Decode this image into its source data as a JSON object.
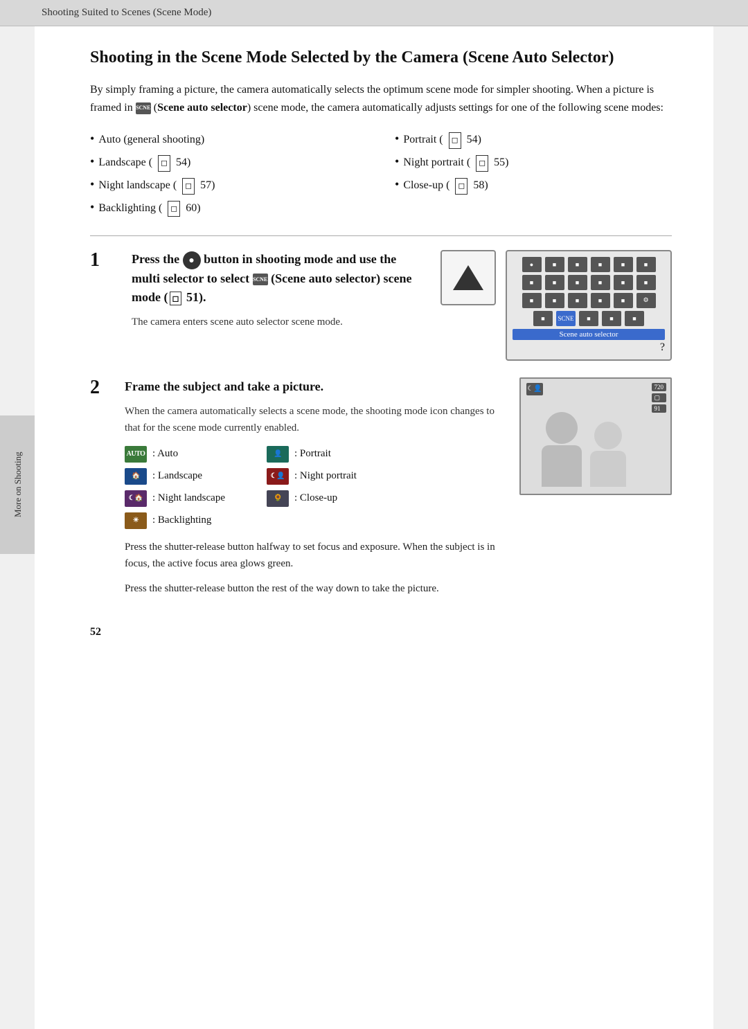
{
  "header": {
    "text": "Shooting Suited to Scenes (Scene Mode)"
  },
  "sideTab": {
    "label": "More on Shooting"
  },
  "main": {
    "title": "Shooting in the Scene Mode Selected by the Camera (Scene Auto Selector)",
    "intro": "By simply framing a picture, the camera automatically selects the optimum scene mode for simpler shooting. When a picture is framed in",
    "intro_bold": "Scene auto selector",
    "intro_end": "scene mode, the camera automatically adjusts settings for one of the following scene modes:",
    "bullets_left": [
      "Auto (general shooting)",
      "Landscape (◻ 54)",
      "Night landscape (◻ 57)",
      "Backlighting (◻ 60)"
    ],
    "bullets_right": [
      "Portrait (◻ 54)",
      "Night portrait (◻ 55)",
      "Close-up (◻ 58)"
    ],
    "step1": {
      "number": "1",
      "title": "Press the 🎯 button in shooting mode and use the multi selector to select",
      "title_bold": "(Scene auto selector)",
      "title_end": "scene mode (◻ 51).",
      "body": "The camera enters scene auto selector scene mode.",
      "menu_label": "Scene auto selector"
    },
    "step2": {
      "number": "2",
      "title": "Frame the subject and take a picture.",
      "body": "When the camera automatically selects a scene mode, the shooting mode icon changes to that for the scene mode currently enabled.",
      "icons": [
        {
          "symbol": "AUTO",
          "label": ": Auto",
          "col": 1
        },
        {
          "symbol": "🌄",
          "label": ": Landscape",
          "col": 1
        },
        {
          "symbol": "🌙🌄",
          "label": ": Night landscape",
          "col": 1
        },
        {
          "symbol": "⬛",
          "label": ": Backlighting",
          "col": 1
        },
        {
          "symbol": "👤",
          "label": ": Portrait",
          "col": 2
        },
        {
          "symbol": "🌙👤",
          "label": ": Night portrait",
          "col": 2
        },
        {
          "symbol": "🌸",
          "label": ": Close-up",
          "col": 2
        }
      ],
      "note1": "Press the shutter-release button halfway to set focus and exposure. When the subject is in focus, the active focus area glows green.",
      "note2": "Press the shutter-release button the rest of the way down to take the picture."
    },
    "page_number": "52"
  }
}
